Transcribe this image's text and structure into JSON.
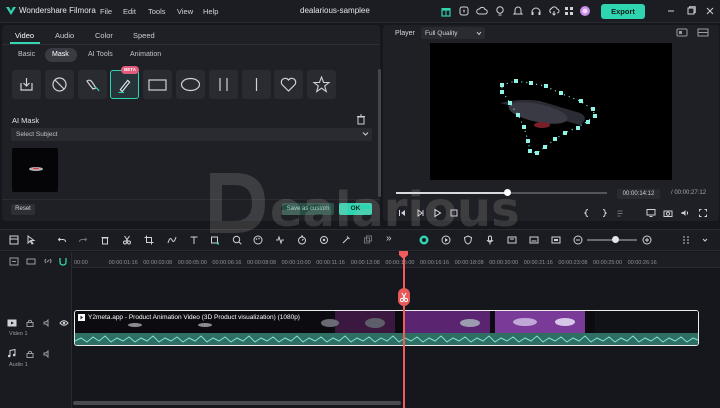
{
  "app": {
    "name": "Wondershare Filmora",
    "menu": [
      "File",
      "Edit",
      "Tools",
      "View",
      "Help"
    ],
    "document_title": "dealarious-samplee",
    "export_label": "Export",
    "accent_color": "#2fd4b0"
  },
  "left_panel": {
    "tabs": [
      "Video",
      "Audio",
      "Color",
      "Speed"
    ],
    "active_tab": "Video",
    "subtabs": [
      "Basic",
      "Mask",
      "AI Tools",
      "Animation"
    ],
    "active_subtab": "Mask",
    "mask_shapes": [
      "import-mask-icon",
      "none-mask-icon",
      "brush-draw-icon",
      "pen-mask-icon",
      "rectangle-mask-icon",
      "ellipse-mask-icon",
      "double-line-mask-icon",
      "single-line-mask-icon",
      "heart-mask-icon",
      "star-mask-icon"
    ],
    "beta_badge": "BETA",
    "ai_mask_label": "AI Mask",
    "select_placeholder": "Select Subject",
    "reset_label": "Reset",
    "save_custom_label": "Save as custom",
    "ok_label": "OK"
  },
  "player": {
    "label": "Player",
    "quality": "Full Quality",
    "current_time": "00:00:14:12",
    "total_time": "/ 00:00:27:12",
    "progress": 0.53
  },
  "timeline": {
    "ruler_ticks": [
      "00:00",
      "00:00:01:16",
      "00:00:03:08",
      "00:00:05:00",
      "00:00:06:16",
      "00:00:08:08",
      "00:00:10:00",
      "00:00:11:16",
      "00:00:13:08",
      "00:00:15:00",
      "00:00:16:16",
      "00:00:18:08",
      "00:00:20:00",
      "00:00:21:16",
      "00:00:23:08",
      "00:00:25:00",
      "00:00:26:16"
    ],
    "video_track_label": "Video 1",
    "audio_track_label": "Audio 1",
    "clip_title": "Y2meta.app - Product Animation Video (3D Product visualization) (1080p)",
    "zoom_level": 0.55
  },
  "watermark": "Dealarious"
}
